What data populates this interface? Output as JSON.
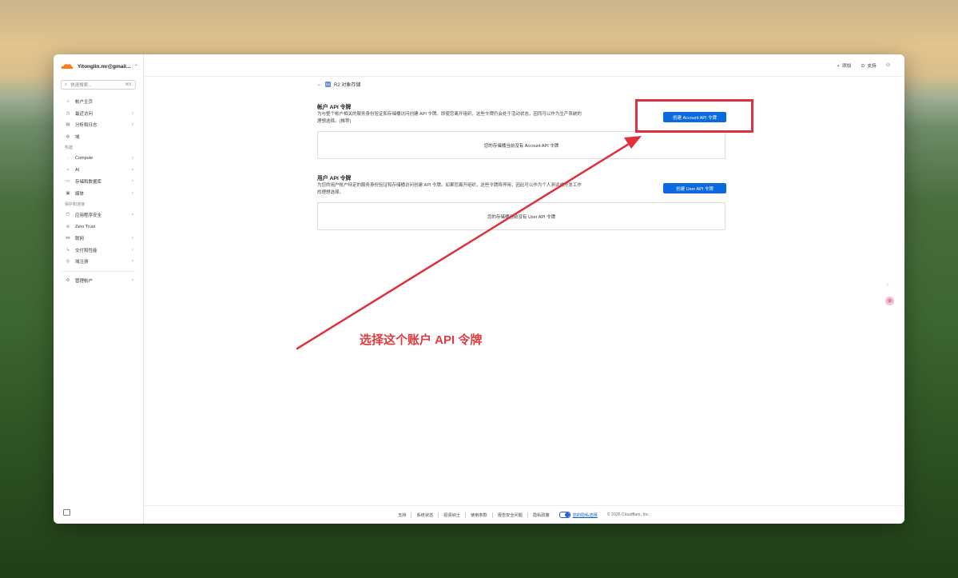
{
  "account": {
    "name": "Yitonglin.mr@gmail...."
  },
  "search": {
    "placeholder": "快速搜索...",
    "shortcut": "⌘K"
  },
  "nav": {
    "items_top": [
      {
        "label": "帐户主页",
        "icon": "home-icon",
        "glyph": "⌂",
        "has_arrow": false
      },
      {
        "label": "最近访问",
        "icon": "clock-icon",
        "glyph": "◷",
        "has_arrow": true
      },
      {
        "label": "分析和日志",
        "icon": "chart-icon",
        "glyph": "▤",
        "has_arrow": true
      },
      {
        "label": "域",
        "icon": "globe-icon",
        "glyph": "◍",
        "has_arrow": false
      }
    ],
    "section_build": "构建",
    "items_build": [
      {
        "label": "Compute",
        "icon": "compute-icon",
        "glyph": "◌",
        "has_arrow": true
      },
      {
        "label": "AI",
        "icon": "ai-icon",
        "glyph": "✧",
        "has_arrow": true
      },
      {
        "label": "存储和数据库",
        "icon": "database-icon",
        "glyph": "▭",
        "has_arrow": true
      },
      {
        "label": "媒体",
        "icon": "media-icon",
        "glyph": "▣",
        "has_arrow": true
      }
    ],
    "section_protect": "保护和连接",
    "items_protect": [
      {
        "label": "应用程序安全",
        "icon": "shield-icon",
        "glyph": "⛉",
        "has_arrow": true
      },
      {
        "label": "Zero Trust",
        "icon": "zero-trust-icon",
        "glyph": "⊘",
        "has_arrow": false
      },
      {
        "label": "联网",
        "icon": "network-icon",
        "glyph": "⋈",
        "has_arrow": true
      },
      {
        "label": "交付和性能",
        "icon": "lightning-icon",
        "glyph": "ϟ",
        "has_arrow": true
      },
      {
        "label": "域注册",
        "icon": "registrar-icon",
        "glyph": "◎",
        "has_arrow": true
      }
    ],
    "items_bottom": [
      {
        "label": "管理帐户",
        "icon": "gear-icon",
        "glyph": "⚙",
        "has_arrow": true
      }
    ]
  },
  "topbar": {
    "add_label": "添加",
    "support_label": "支持"
  },
  "breadcrumb": {
    "back": "←",
    "badge": "R2",
    "label": "R2 对象存储"
  },
  "account_tokens": {
    "title": "帐户 API 令牌",
    "description": "为与整个帐户相关的服务身份验证和存储桶访问创建 API 令牌。即使您离开组织，这些令牌仍会处于活动状态，因而可以作为生产系统的理想选择。(推荐)",
    "button": "创建 Account API 令牌",
    "empty": "您的存储桶当前没有 Account API 令牌"
  },
  "user_tokens": {
    "title": "用户 API 令牌",
    "description": "为您的用户帐户特定的服务身份验证和存储桶访问创建 API 令牌。如果您离开组织，这些令牌将停用，因此可以作为个人测试或开发工作的理想选择。",
    "button": "创建 User API 令牌",
    "empty": "您的存储桶当前没有 User API 令牌"
  },
  "footer": {
    "links": [
      "支持",
      "系统状态",
      "招贤纳士",
      "使用条款",
      "报告安全问题",
      "隐私政策"
    ],
    "privacy_choice": "您的隐私选择",
    "copyright": "© 2026 Cloudflare, Inc."
  },
  "annotation": {
    "text": "选择这个账户 API 令牌",
    "color": "#e23a3f"
  },
  "colors": {
    "accent": "#0b6bde",
    "highlight": "#e0303c"
  }
}
